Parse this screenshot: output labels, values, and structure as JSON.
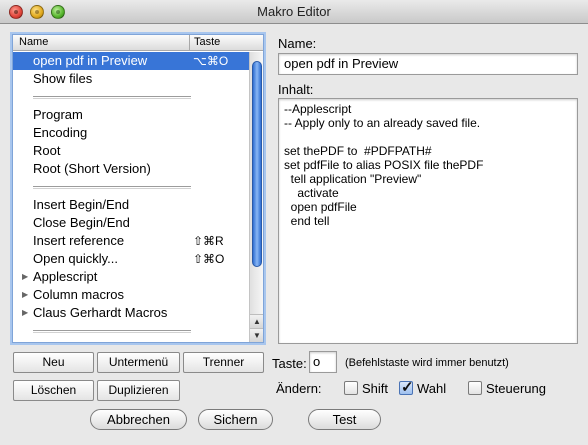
{
  "window": {
    "title": "Makro Editor"
  },
  "list": {
    "columns": {
      "name": "Name",
      "key": "Taste"
    },
    "rows": [
      {
        "type": "item",
        "label": "open pdf in Preview",
        "key": "⌥⌘O",
        "selected": true
      },
      {
        "type": "item",
        "label": "Show files",
        "key": ""
      },
      {
        "type": "separator"
      },
      {
        "type": "item",
        "label": "Program",
        "key": ""
      },
      {
        "type": "item",
        "label": "Encoding",
        "key": ""
      },
      {
        "type": "item",
        "label": "Root",
        "key": ""
      },
      {
        "type": "item",
        "label": "Root (Short Version)",
        "key": ""
      },
      {
        "type": "separator"
      },
      {
        "type": "item",
        "label": "Insert Begin/End",
        "key": ""
      },
      {
        "type": "item",
        "label": "Close Begin/End",
        "key": ""
      },
      {
        "type": "item",
        "label": "Insert reference",
        "key": "⇧⌘R"
      },
      {
        "type": "item",
        "label": "Open quickly...",
        "key": "⇧⌘O"
      },
      {
        "type": "folder",
        "label": "Applescript",
        "key": ""
      },
      {
        "type": "folder",
        "label": "Column macros",
        "key": ""
      },
      {
        "type": "folder",
        "label": "Claus Gerhardt Macros",
        "key": ""
      },
      {
        "type": "separator"
      }
    ]
  },
  "buttons": {
    "neu": "Neu",
    "untermenu": "Untermenü",
    "trenner": "Trenner",
    "loeschen": "Löschen",
    "duplizieren": "Duplizieren",
    "abbrechen": "Abbrechen",
    "sichern": "Sichern",
    "test": "Test"
  },
  "name_label": "Name:",
  "name_value": "open pdf in Preview",
  "inhalt_label": "Inhalt:",
  "inhalt_lines": [
    "--Applescript",
    "-- Apply only to an already saved file.",
    "",
    "set thePDF to  #PDFPATH#",
    "set pdfFile to alias POSIX file thePDF",
    "  tell application \"Preview\"",
    "    activate",
    "  open pdfFile",
    "  end tell"
  ],
  "taste": {
    "label": "Taste:",
    "value": "o",
    "hint": "(Befehlstaste wird immer benutzt)"
  },
  "aendern": {
    "label": "Ändern:",
    "shift": {
      "label": "Shift",
      "checked": false
    },
    "wahl": {
      "label": "Wahl",
      "checked": true
    },
    "steuerung": {
      "label": "Steuerung",
      "checked": false
    }
  }
}
